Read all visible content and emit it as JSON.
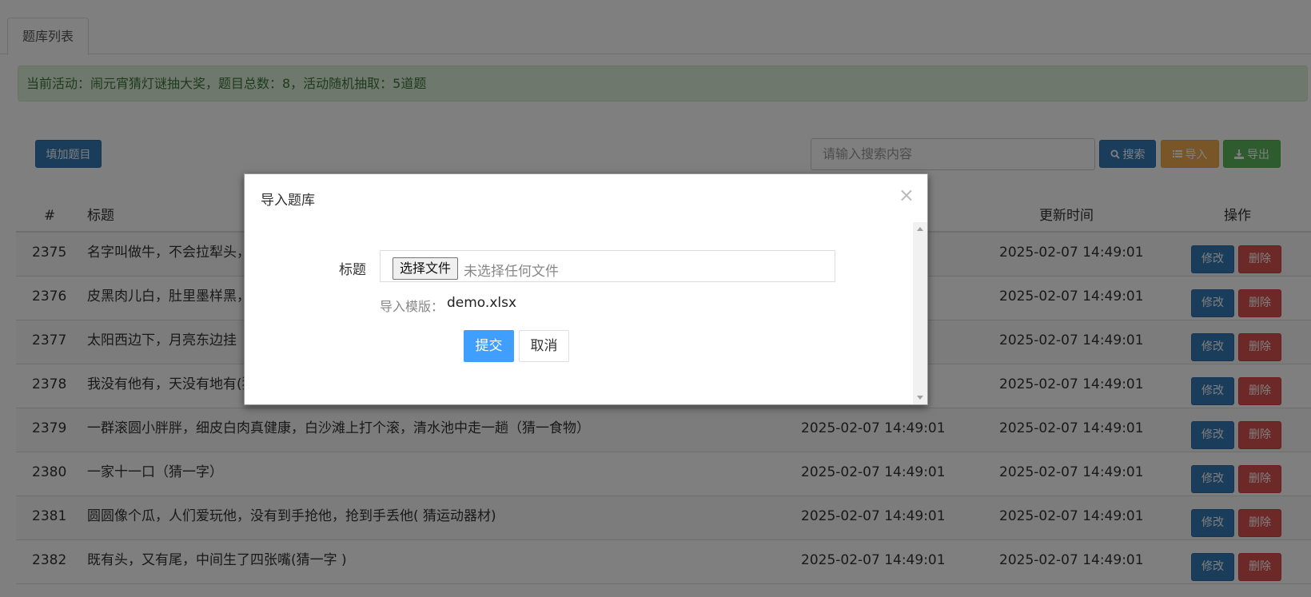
{
  "tab": {
    "label": "题库列表"
  },
  "alert": {
    "text": "当前活动：闹元宵猜灯谜抽大奖，题目总数：8，活动随机抽取：5道题"
  },
  "toolbar": {
    "add_label": "填加题目",
    "search_placeholder": "请输入搜索内容",
    "search_label": "搜索",
    "import_label": "导入",
    "export_label": "导出"
  },
  "table": {
    "headers": {
      "id": "#",
      "title": "标题",
      "update_time": "更新时间",
      "actions": "操作"
    },
    "edit_label": "修改",
    "delete_label": "删除",
    "rows": [
      {
        "id": "2375",
        "title": "名字叫做牛，不会拉犁头，",
        "created": "",
        "updated": "2025-02-07 14:49:01"
      },
      {
        "id": "2376",
        "title": "皮黑肉儿白，肚里墨样黑，",
        "created": "",
        "updated": "2025-02-07 14:49:01"
      },
      {
        "id": "2377",
        "title": "太阳西边下，月亮东边挂（猜",
        "created": "",
        "updated": "2025-02-07 14:49:01"
      },
      {
        "id": "2378",
        "title": "我没有他有，天没有地有(猜",
        "created": "",
        "updated": "2025-02-07 14:49:01"
      },
      {
        "id": "2379",
        "title": "一群滚圆小胖胖，细皮白肉真健康，白沙滩上打个滚，清水池中走一趟（猜一食物）",
        "created": "2025-02-07 14:49:01",
        "updated": "2025-02-07 14:49:01"
      },
      {
        "id": "2380",
        "title": "一家十一口（猜一字）",
        "created": "2025-02-07 14:49:01",
        "updated": "2025-02-07 14:49:01"
      },
      {
        "id": "2381",
        "title": "圆圆像个瓜，人们爱玩他，没有到手抢他，抢到手丢他( 猜运动器材)",
        "created": "2025-02-07 14:49:01",
        "updated": "2025-02-07 14:49:01"
      },
      {
        "id": "2382",
        "title": "既有头，又有尾，中间生了四张嘴(猜一字 )",
        "created": "2025-02-07 14:49:01",
        "updated": "2025-02-07 14:49:01"
      }
    ]
  },
  "modal": {
    "title": "导入题库",
    "close_symbol": "×",
    "field_label": "标题",
    "file_button_label": "选择文件",
    "file_status": "未选择任何文件",
    "template_label": "导入模版：",
    "template_file": "demo.xlsx",
    "submit_label": "提交",
    "cancel_label": "取消"
  }
}
